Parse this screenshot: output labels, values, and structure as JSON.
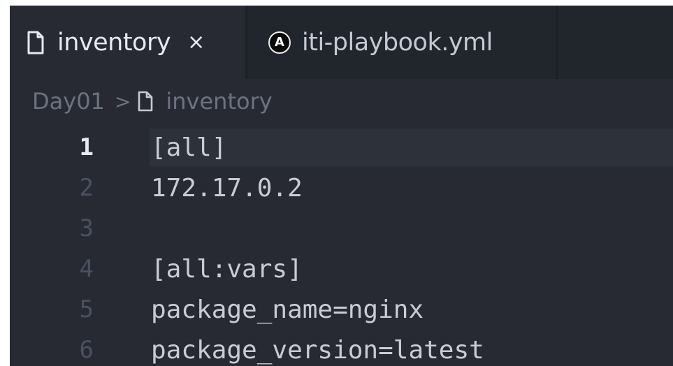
{
  "tabs": [
    {
      "label": "inventory",
      "icon": "file-icon",
      "active": true,
      "close_symbol": "×"
    },
    {
      "label": "iti-playbook.yml",
      "icon": "ansible-icon",
      "icon_letter": "A",
      "active": false
    }
  ],
  "breadcrumb": {
    "folder": "Day01",
    "separator": ">",
    "file": "inventory"
  },
  "editor": {
    "current_line": 1,
    "lines": [
      {
        "number": "1",
        "text": "[all]"
      },
      {
        "number": "2",
        "text": "172.17.0.2"
      },
      {
        "number": "3",
        "text": ""
      },
      {
        "number": "4",
        "text": "[all:vars]"
      },
      {
        "number": "5",
        "text": "package_name=nginx"
      },
      {
        "number": "6",
        "text": "package_version=latest"
      }
    ]
  },
  "colors": {
    "editor_bg": "#272a33",
    "tabbar_bg": "#21252c",
    "current_line_bg": "#2c313a",
    "text": "#c8ccd4",
    "line_number_dim": "#4a5160"
  }
}
